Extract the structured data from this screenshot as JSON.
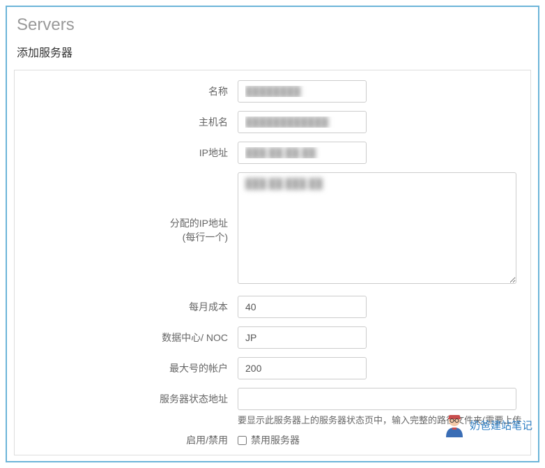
{
  "page": {
    "title": "Servers",
    "section": "添加服务器"
  },
  "form": {
    "name": {
      "label": "名称",
      "value": "████████"
    },
    "hostname": {
      "label": "主机名",
      "value": "████████████"
    },
    "ip": {
      "label": "IP地址",
      "value": "███.██.██.██"
    },
    "assigned_ip": {
      "label_line1": "分配的IP地址",
      "label_line2": "(每行一个)",
      "value": "███.██.███.██"
    },
    "monthly_cost": {
      "label": "每月成本",
      "value": "40"
    },
    "datacenter": {
      "label": "数据中心/ NOC",
      "value": "JP"
    },
    "max_accounts": {
      "label": "最大号的帐户",
      "value": "200"
    },
    "status_url": {
      "label": "服务器状态地址",
      "value": "",
      "helper": "要显示此服务器上的服务器状态页中，输入完整的路径文件夹(需要上传"
    },
    "enable": {
      "label": "启用/禁用",
      "checkbox_label": "禁用服务器",
      "checked": false
    }
  },
  "watermark": {
    "text": "奶爸建站笔记"
  }
}
